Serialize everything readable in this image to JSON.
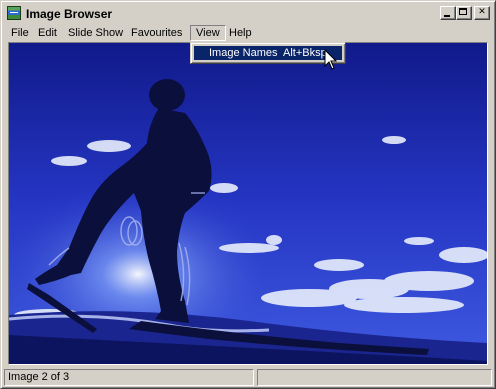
{
  "window": {
    "title": "Image Browser",
    "icon": "app-icon",
    "controls": [
      "minimize-icon",
      "maximize-icon",
      "close-icon"
    ]
  },
  "menubar": {
    "items": [
      {
        "label": "File"
      },
      {
        "label": "Edit"
      },
      {
        "label": "Slide Show"
      },
      {
        "label": "Favourites"
      },
      {
        "label": "View"
      },
      {
        "label": "Help"
      }
    ],
    "active": "View"
  },
  "view_menu": {
    "items": [
      {
        "label": "Image Names",
        "shortcut": "Alt+Bksp",
        "highlighted": true
      }
    ]
  },
  "image": {
    "subject": "silhouette of a hiker on snowshoes against a blue sky"
  },
  "statusbar": {
    "position_text": "Image 2 of 3",
    "secondary_text": ""
  },
  "colors": {
    "face": "#d4d0c8",
    "highlight": "#0a246a",
    "sky": "#1f2fb8"
  }
}
